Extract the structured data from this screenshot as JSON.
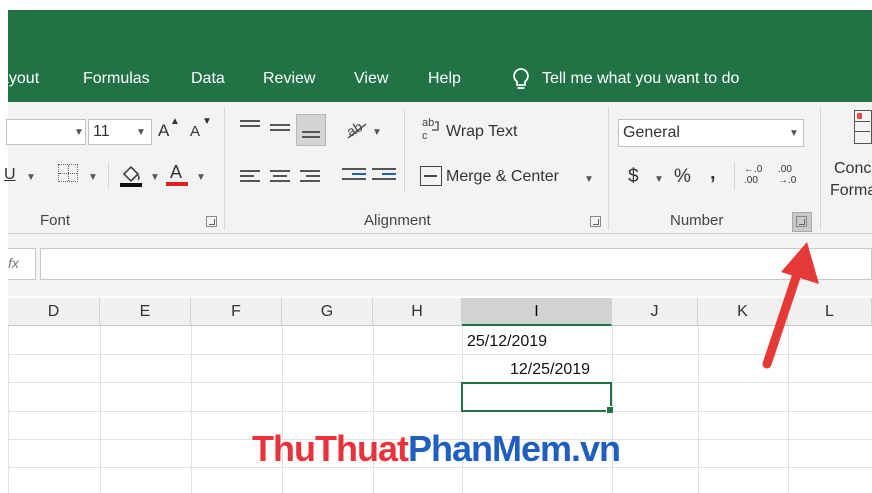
{
  "tabs": [
    "ayout",
    "Formulas",
    "Data",
    "Review",
    "View",
    "Help"
  ],
  "tell_me": "Tell me what you want to do",
  "font_group": {
    "size": "11",
    "grow_label": "A",
    "shrink_label": "A",
    "underline": "U",
    "font_color_label": "A",
    "group_label": "Font"
  },
  "alignment_group": {
    "wrap_text": "Wrap Text",
    "merge_center": "Merge & Center",
    "group_label": "Alignment"
  },
  "number_group": {
    "format": "General",
    "currency": "$",
    "percent": "%",
    "comma": ",",
    "inc_decimal": "←.0\n.00",
    "dec_decimal": ".00\n→.0",
    "group_label": "Number"
  },
  "styles_partial": {
    "line1": "Conc",
    "line2": "Forma"
  },
  "formula_bar": {
    "fx": "fx",
    "value": ""
  },
  "columns": [
    "D",
    "E",
    "F",
    "G",
    "H",
    "I",
    "J",
    "K",
    "L"
  ],
  "cells": {
    "i1": "25/12/2019",
    "i2": "12/25/2019"
  },
  "watermark": {
    "part1": "ThuThuat",
    "part2": "PhanMem",
    "part3": ".vn"
  },
  "colors": {
    "excel_green": "#217346",
    "arrow_red": "#e53935",
    "watermark_red": "#e8323c",
    "watermark_blue": "#1f5fbf"
  }
}
